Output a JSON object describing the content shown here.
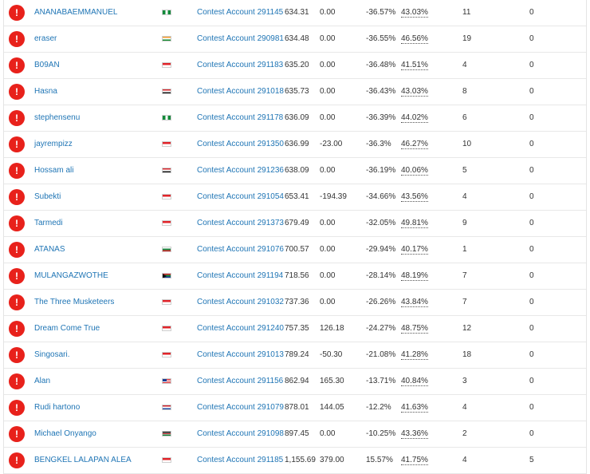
{
  "status_icon": {
    "glyph": "!",
    "icon": "alert-icon",
    "color": "#e8211b"
  },
  "colors": {
    "link": "#1f75b5",
    "text": "#333333",
    "divider": "#e8e8e8"
  },
  "rows": [
    {
      "name": "ANANABAEMMANUEL",
      "flag": "ng",
      "account": "Contest Account 291145",
      "balance": "634.31",
      "profit": "0.00",
      "gain": "-36.57%",
      "winrate": "43.03%",
      "trades": "11",
      "lots": "0"
    },
    {
      "name": "eraser",
      "flag": "in",
      "account": "Contest Account 290981",
      "balance": "634.48",
      "profit": "0.00",
      "gain": "-36.55%",
      "winrate": "46.56%",
      "trades": "19",
      "lots": "0"
    },
    {
      "name": "B09AN",
      "flag": "id",
      "account": "Contest Account 291183",
      "balance": "635.20",
      "profit": "0.00",
      "gain": "-36.48%",
      "winrate": "41.51%",
      "trades": "4",
      "lots": "0"
    },
    {
      "name": "Hasna",
      "flag": "eg",
      "account": "Contest Account 291018",
      "balance": "635.73",
      "profit": "0.00",
      "gain": "-36.43%",
      "winrate": "43.03%",
      "trades": "8",
      "lots": "0"
    },
    {
      "name": "stephensenu",
      "flag": "ng",
      "account": "Contest Account 291178",
      "balance": "636.09",
      "profit": "0.00",
      "gain": "-36.39%",
      "winrate": "44.02%",
      "trades": "6",
      "lots": "0"
    },
    {
      "name": "jayrempizz",
      "flag": "id",
      "account": "Contest Account 291350",
      "balance": "636.99",
      "profit": "-23.00",
      "gain": "-36.3%",
      "winrate": "46.27%",
      "trades": "10",
      "lots": "0"
    },
    {
      "name": "Hossam ali",
      "flag": "eg",
      "account": "Contest Account 291236",
      "balance": "638.09",
      "profit": "0.00",
      "gain": "-36.19%",
      "winrate": "40.06%",
      "trades": "5",
      "lots": "0"
    },
    {
      "name": "Subekti",
      "flag": "id",
      "account": "Contest Account 291054",
      "balance": "653.41",
      "profit": "-194.39",
      "gain": "-34.66%",
      "winrate": "43.56%",
      "trades": "4",
      "lots": "0"
    },
    {
      "name": "Tarmedi",
      "flag": "id",
      "account": "Contest Account 291373",
      "balance": "679.49",
      "profit": "0.00",
      "gain": "-32.05%",
      "winrate": "49.81%",
      "trades": "9",
      "lots": "0"
    },
    {
      "name": "ATANAS",
      "flag": "bg",
      "account": "Contest Account 291076",
      "balance": "700.57",
      "profit": "0.00",
      "gain": "-29.94%",
      "winrate": "40.17%",
      "trades": "1",
      "lots": "0"
    },
    {
      "name": "MULANGAZWOTHE",
      "flag": "za",
      "account": "Contest Account 291194",
      "balance": "718.56",
      "profit": "0.00",
      "gain": "-28.14%",
      "winrate": "48.19%",
      "trades": "7",
      "lots": "0"
    },
    {
      "name": "The Three Musketeers",
      "flag": "id",
      "account": "Contest Account 291032",
      "balance": "737.36",
      "profit": "0.00",
      "gain": "-26.26%",
      "winrate": "43.84%",
      "trades": "7",
      "lots": "0"
    },
    {
      "name": "Dream Come True",
      "flag": "id",
      "account": "Contest Account 291240",
      "balance": "757.35",
      "profit": "126.18",
      "gain": "-24.27%",
      "winrate": "48.75%",
      "trades": "12",
      "lots": "0"
    },
    {
      "name": "Singosari.",
      "flag": "id",
      "account": "Contest Account 291013",
      "balance": "789.24",
      "profit": "-50.30",
      "gain": "-21.08%",
      "winrate": "41.28%",
      "trades": "18",
      "lots": "0"
    },
    {
      "name": "Alan",
      "flag": "my",
      "account": "Contest Account 291156",
      "balance": "862.94",
      "profit": "165.30",
      "gain": "-13.71%",
      "winrate": "40.84%",
      "trades": "3",
      "lots": "0"
    },
    {
      "name": "Rudi hartono",
      "flag": "nl",
      "account": "Contest Account 291079",
      "balance": "878.01",
      "profit": "144.05",
      "gain": "-12.2%",
      "winrate": "41.63%",
      "trades": "4",
      "lots": "0"
    },
    {
      "name": "Michael Onyango",
      "flag": "ke",
      "account": "Contest Account 291098",
      "balance": "897.45",
      "profit": "0.00",
      "gain": "-10.25%",
      "winrate": "43.36%",
      "trades": "2",
      "lots": "0"
    },
    {
      "name": "BENGKEL LALAPAN ALEA",
      "flag": "id",
      "account": "Contest Account 291185",
      "balance": "1,155.69",
      "profit": "379.00",
      "gain": "15.57%",
      "winrate": "41.75%",
      "trades": "4",
      "lots": "5"
    }
  ]
}
